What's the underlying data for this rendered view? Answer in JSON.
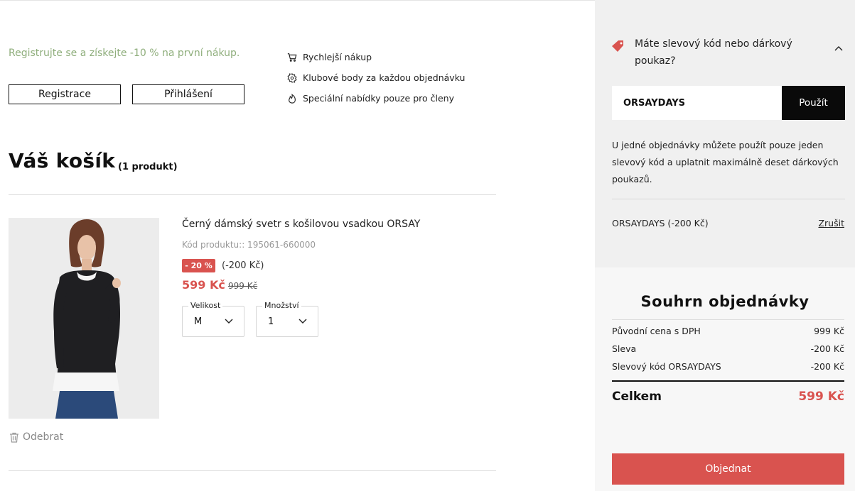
{
  "promo": {
    "text": "Registrujte se a získejte -10 % na první nákup.",
    "register_label": "Registrace",
    "login_label": "Přihlášení",
    "benefits": [
      {
        "icon": "cart-icon",
        "label": "Rychlejší nákup"
      },
      {
        "icon": "star-badge-icon",
        "label": "Klubové body za každou objednávku"
      },
      {
        "icon": "flame-icon",
        "label": "Speciální nabídky pouze pro členy"
      }
    ]
  },
  "cart": {
    "title": "Váš košík",
    "count": "(1 produkt)",
    "item": {
      "name": "Černý dámský svetr s košilovou vsadkou ORSAY",
      "code": "Kód produktu:: 195061-660000",
      "discount_badge": "- 20 %",
      "saving": "(-200 Kč)",
      "price": "599 Kč",
      "old_price": "999 Kč",
      "size_label": "Velikost",
      "size_value": "M",
      "qty_label": "Množství",
      "qty_value": "1",
      "remove_label": "Odebrat"
    }
  },
  "coupon": {
    "title": "Máte slevový kód nebo dárkový poukaz?",
    "input_value": "ORSAYDAYS",
    "apply_label": "Použít",
    "note": "U jedné objednávky můžete použít pouze jeden slevový kód a uplatnit maximálně deset dárkových poukazů.",
    "applied": "ORSAYDAYS (-200 Kč)",
    "cancel_label": "Zrušit"
  },
  "summary": {
    "title": "Souhrn objednávky",
    "rows": [
      {
        "label": "Původní cena s DPH",
        "value": "999 Kč"
      },
      {
        "label": "Sleva",
        "value": "-200 Kč"
      },
      {
        "label": "Slevový kód ORSAYDAYS",
        "value": "-200 Kč"
      }
    ],
    "total_label": "Celkem",
    "total_value": "599 Kč",
    "order_label": "Objednat"
  },
  "colors": {
    "accent_red": "#d9534f",
    "promo_green": "#8fae7c",
    "sidebar_bg": "#f0f0f0"
  }
}
